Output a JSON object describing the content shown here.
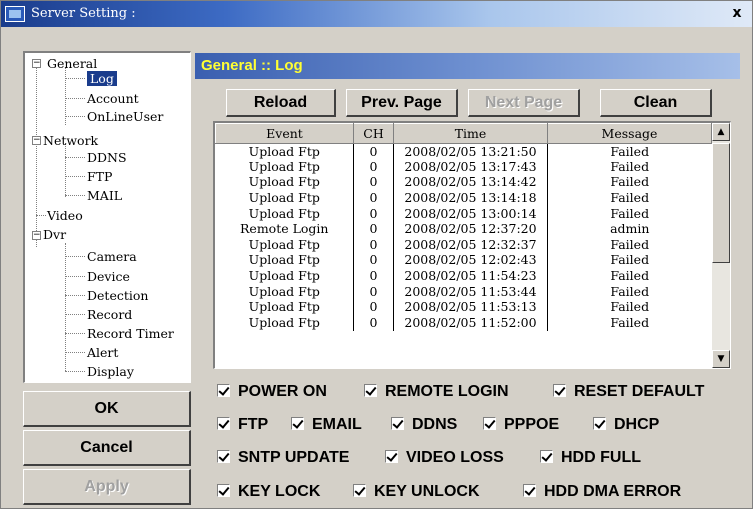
{
  "window": {
    "title": "Server Setting :",
    "close_label": "x"
  },
  "tree": {
    "general": "General",
    "log": "Log",
    "account": "Account",
    "online_user": "OnLineUser",
    "network": "Network",
    "ddns": "DDNS",
    "ftp": "FTP",
    "mail": "MAIL",
    "video": "Video",
    "dvr": "Dvr",
    "camera": "Camera",
    "device": "Device",
    "detection": "Detection",
    "record": "Record",
    "record_timer": "Record Timer",
    "alert": "Alert",
    "display": "Display"
  },
  "buttons": {
    "ok": "OK",
    "cancel": "Cancel",
    "apply": "Apply"
  },
  "section": {
    "title": "General :: Log"
  },
  "toolbar": {
    "reload": "Reload",
    "prev_page": "Prev. Page",
    "next_page": "Next Page",
    "clean": "Clean"
  },
  "log_table": {
    "headers": {
      "event": "Event",
      "ch": "CH",
      "time": "Time",
      "message": "Message"
    },
    "rows": [
      {
        "event": "Upload Ftp",
        "ch": "0",
        "time": "2008/02/05 13:21:50",
        "message": "Failed"
      },
      {
        "event": "Upload Ftp",
        "ch": "0",
        "time": "2008/02/05 13:17:43",
        "message": "Failed"
      },
      {
        "event": "Upload Ftp",
        "ch": "0",
        "time": "2008/02/05 13:14:42",
        "message": "Failed"
      },
      {
        "event": "Upload Ftp",
        "ch": "0",
        "time": "2008/02/05 13:14:18",
        "message": "Failed"
      },
      {
        "event": "Upload Ftp",
        "ch": "0",
        "time": "2008/02/05 13:00:14",
        "message": "Failed"
      },
      {
        "event": "Remote Login",
        "ch": "0",
        "time": "2008/02/05 12:37:20",
        "message": "admin"
      },
      {
        "event": "Upload Ftp",
        "ch": "0",
        "time": "2008/02/05 12:32:37",
        "message": "Failed"
      },
      {
        "event": "Upload Ftp",
        "ch": "0",
        "time": "2008/02/05 12:02:43",
        "message": "Failed"
      },
      {
        "event": "Upload Ftp",
        "ch": "0",
        "time": "2008/02/05 11:54:23",
        "message": "Failed"
      },
      {
        "event": "Upload Ftp",
        "ch": "0",
        "time": "2008/02/05 11:53:44",
        "message": "Failed"
      },
      {
        "event": "Upload Ftp",
        "ch": "0",
        "time": "2008/02/05 11:53:13",
        "message": "Failed"
      },
      {
        "event": "Upload Ftp",
        "ch": "0",
        "time": "2008/02/05 11:52:00",
        "message": "Failed"
      }
    ]
  },
  "filters": {
    "power_on": "POWER ON",
    "remote_login": "REMOTE LOGIN",
    "reset_default": "RESET DEFAULT",
    "ftp": "FTP",
    "email": "EMAIL",
    "ddns": "DDNS",
    "pppoe": "PPPOE",
    "dhcp": "DHCP",
    "sntp_update": "SNTP UPDATE",
    "video_loss": "VIDEO LOSS",
    "hdd_full": "HDD FULL",
    "key_lock": "KEY LOCK",
    "key_unlock": "KEY UNLOCK",
    "hdd_dma_error": "HDD DMA ERROR"
  }
}
